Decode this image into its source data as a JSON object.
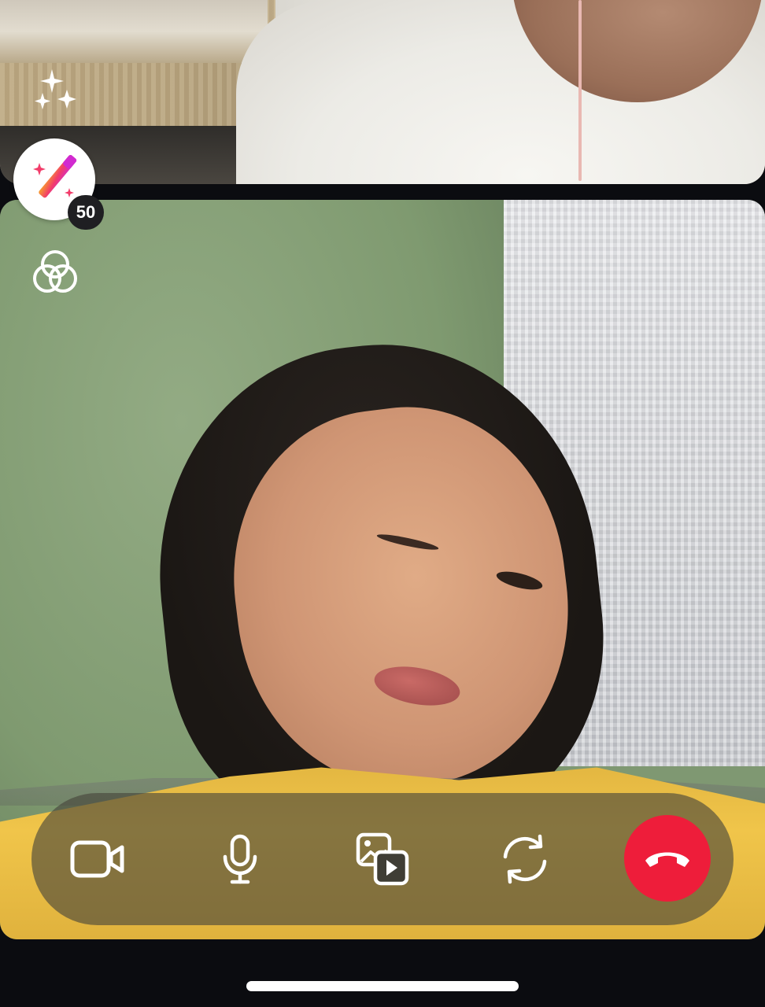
{
  "effects": {
    "count": "50"
  },
  "icons": {
    "sparkles": "sparkles-icon",
    "effects": "magic-wand-icon",
    "filters": "overlapping-circles-icon",
    "video": "video-camera-icon",
    "microphone": "microphone-icon",
    "media": "photo-video-icon",
    "flip_camera": "flip-camera-icon",
    "end_call": "phone-hangup-icon"
  },
  "colors": {
    "end_call": "#ee1d3a",
    "controls_bar": "rgba(70,68,58,0.62)",
    "badge_bg": "#1f1f22",
    "background": "#0b0c10"
  }
}
